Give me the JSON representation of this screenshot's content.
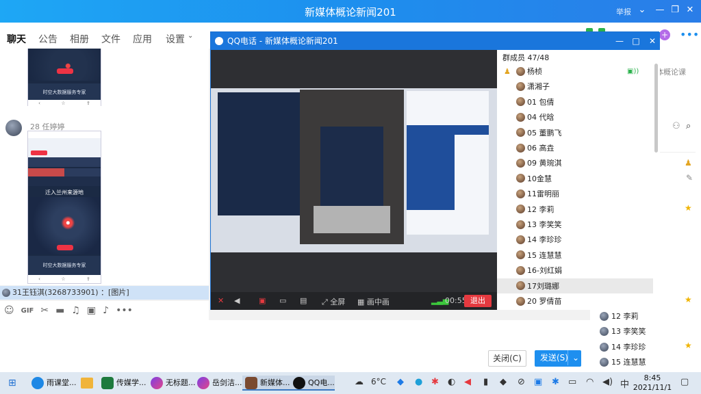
{
  "window": {
    "title": "新媒体概论新闻201",
    "report_label": "举报"
  },
  "tabs": [
    "聊天",
    "公告",
    "相册",
    "文件",
    "应用",
    "设置"
  ],
  "chat": {
    "card_footer": "时空大数据服务专家",
    "sender": "28 任婷婷",
    "phone_title": "迁入兰州来源地",
    "notice": "31王钰淇(3268733901) ：[图片]"
  },
  "buttons": {
    "close": "关闭(C)",
    "send": "发送(S)"
  },
  "qqcall": {
    "title": "QQ电话 - 新媒体概论新闻201",
    "fullscreen": "全屏",
    "pip": "画中画",
    "duration": "00:55",
    "exit": "退出"
  },
  "members": {
    "header": "群成员 47/48",
    "list": [
      "杨桢",
      "潇湘子",
      "01 包倩",
      "04 代晗",
      "05 董鹏飞",
      "06 高垚",
      "09  黄琬淇",
      "10金慧",
      "11雷明丽",
      "12 李莉",
      "13 李笑笑",
      "14 李珍珍",
      "15  连慧慧",
      "16-刘红娟",
      "17刘璐娜",
      "20 罗倩苗"
    ]
  },
  "rightpanel": {
    "top_text": "体概论课",
    "list": [
      "12 李莉",
      "13 李笑笑",
      "14 李珍珍",
      "15  连慧慧"
    ]
  },
  "taskbar": {
    "apps": [
      "雨课堂...",
      "传媒学...",
      "无标题...",
      "岳剑洁...",
      "新媒体...",
      "QQ电..."
    ],
    "weather": "6°C",
    "ime": "中",
    "time": "8:45",
    "date": "2021/11/1"
  },
  "colors": {
    "accent": "#1d8fee",
    "exit": "#e5393f",
    "send": "#1e8fef"
  }
}
